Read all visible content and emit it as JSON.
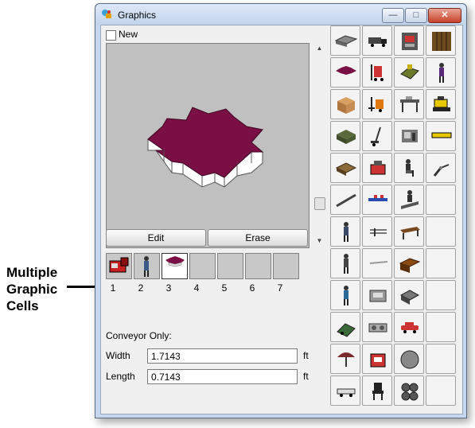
{
  "annotation": {
    "text": "Multiple Graphic Cells"
  },
  "window": {
    "title": "Graphics"
  },
  "new_checkbox": {
    "label": "New",
    "checked": false
  },
  "buttons": {
    "edit": "Edit",
    "erase": "Erase"
  },
  "cells": [
    {
      "number": "1",
      "content": "red-machine"
    },
    {
      "number": "2",
      "content": "worker"
    },
    {
      "number": "3",
      "content": "gear-platform",
      "selected": true
    },
    {
      "number": "4",
      "content": "empty"
    },
    {
      "number": "5",
      "content": "empty"
    },
    {
      "number": "6",
      "content": "empty"
    },
    {
      "number": "7",
      "content": "empty"
    }
  ],
  "conveyor": {
    "label": "Conveyor Only:",
    "width_label": "Width",
    "width_value": "1.7143",
    "width_unit": "ft",
    "length_label": "Length",
    "length_value": "0.7143",
    "length_unit": "ft"
  },
  "colors": {
    "gear": "#7a0f45",
    "gear_side": "#f2f2f2",
    "preview_bg": "#c0c0c0",
    "accent": "#c8412a"
  },
  "palette": [
    [
      "gray-slab",
      "truck",
      "machine-press",
      "wood-crate"
    ],
    [
      "gear-platform",
      "forklift-red",
      "green-machine",
      "worker-purple"
    ],
    [
      "cardboard-box",
      "forklift-orange",
      "workbench",
      "yellow-bulldozer"
    ],
    [
      "green-crate",
      "hand-cart",
      "machine-tool",
      "yellow-bar"
    ],
    [
      "wood-pallet",
      "red-robot",
      "worker-seated",
      "robot-arm"
    ],
    [
      "conveyor-rod",
      "conveyor-blue",
      "worker-treadmill",
      ""
    ],
    [
      "worker-standing",
      "pipe-rack",
      "brown-table",
      ""
    ],
    [
      "worker-standing-2",
      "thin-rail",
      "brown-desk",
      ""
    ],
    [
      "worker-blue",
      "gray-equipment",
      "gray-engine",
      ""
    ],
    [
      "green-loader",
      "lathe",
      "red-car",
      ""
    ],
    [
      "worker-umbrella",
      "red-press",
      "gray-disc",
      ""
    ],
    [
      "small-vehicle",
      "chair",
      "barrels",
      ""
    ]
  ]
}
